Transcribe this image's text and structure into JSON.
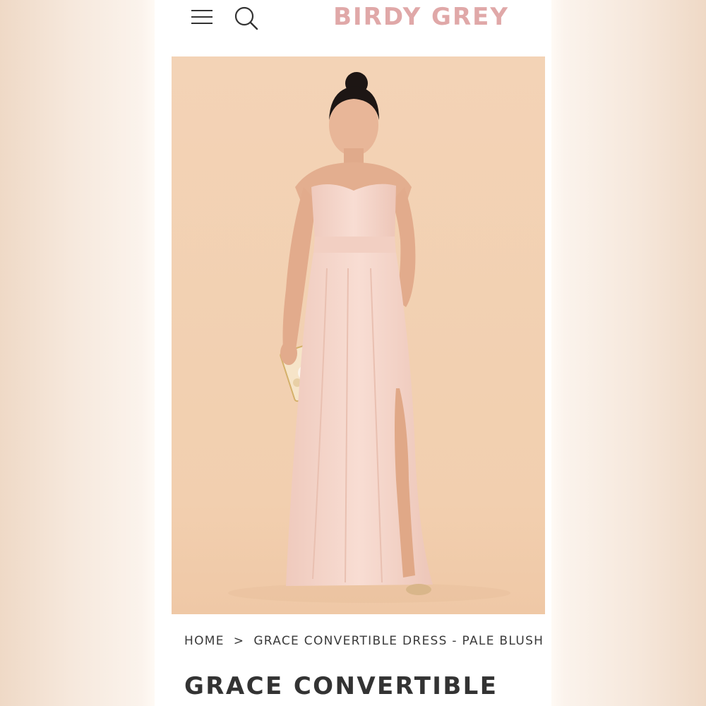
{
  "header": {
    "brand": "BIRDY GREY",
    "menu_icon": "hamburger-menu-icon",
    "search_icon": "search-icon"
  },
  "product_image": {
    "alt": "Woman in pale blush strapless convertible maxi dress holding a clutch"
  },
  "breadcrumb": {
    "home": "HOME",
    "separator": ">",
    "current": "GRACE CONVERTIBLE DRESS - PALE BLUSH"
  },
  "product": {
    "title": "GRACE CONVERTIBLE"
  },
  "colors": {
    "brand": "#e0a8a8",
    "photo_background": "#f3d2b4",
    "dress": "#f4d2c7",
    "text": "#333333"
  }
}
